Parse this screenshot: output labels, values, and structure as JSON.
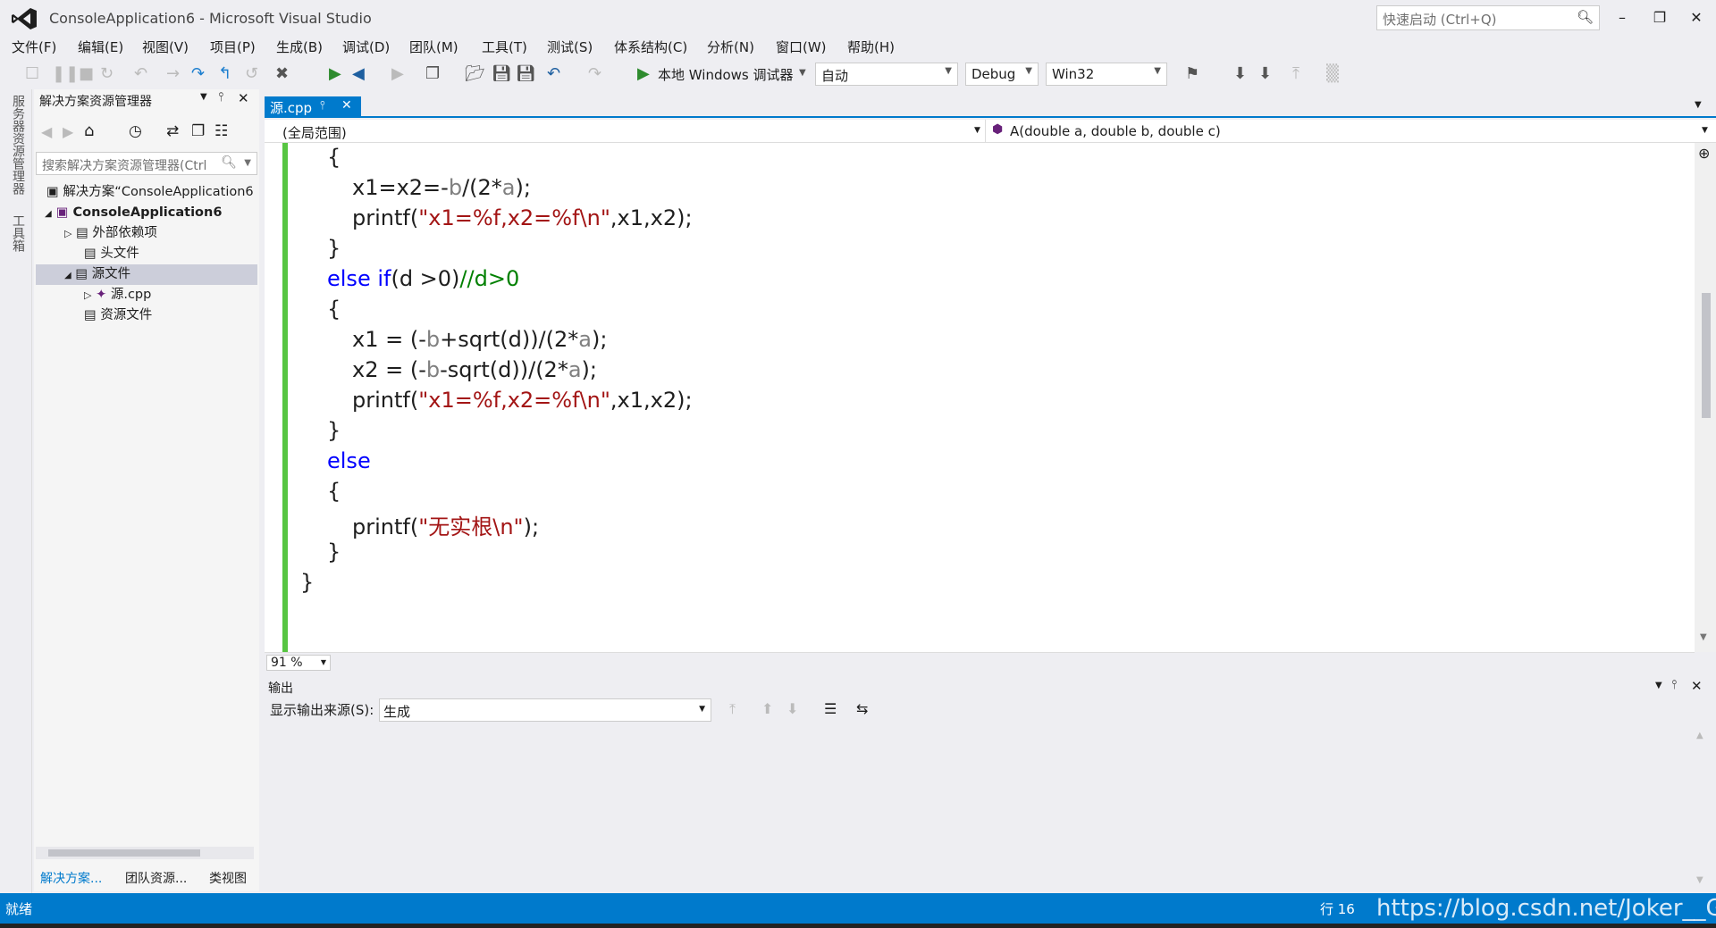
{
  "window": {
    "title": "ConsoleApplication6 - Microsoft Visual Studio",
    "quick_launch_placeholder": "快速启动 (Ctrl+Q)"
  },
  "menu": [
    "文件(F)",
    "编辑(E)",
    "视图(V)",
    "项目(P)",
    "生成(B)",
    "调试(D)",
    "团队(M)",
    "工具(T)",
    "测试(S)",
    "体系结构(C)",
    "分析(N)",
    "窗口(W)",
    "帮助(H)"
  ],
  "toolbar": {
    "debugger": "本地 Windows 调试器",
    "auto": "自动",
    "config": "Debug",
    "platform": "Win32"
  },
  "side_strip": {
    "server_explorer": "服务器资源管理器",
    "toolbox": "工具箱"
  },
  "solution_explorer": {
    "title": "解决方案资源管理器",
    "search_placeholder": "搜索解决方案资源管理器(Ctrl",
    "tree": [
      "解决方案“ConsoleApplication6",
      "ConsoleApplication6",
      "外部依赖项",
      "头文件",
      "源文件",
      "源.cpp",
      "资源文件"
    ],
    "tabs": [
      "解决方案...",
      "团队资源...",
      "类视图"
    ]
  },
  "editor": {
    "tab": "源.cpp",
    "scope": "(全局范围)",
    "member": "A(double a, double b, double c)",
    "zoom": "91 %"
  },
  "output": {
    "title": "输出",
    "source_label": "显示输出来源(S):",
    "source_value": "生成"
  },
  "status": {
    "ready": "就绪",
    "line": "行 16",
    "watermark": "https://blog.csdn.net/Joker__GG"
  },
  "colors": {
    "accent": "#007acc",
    "keyword": "#0000ff",
    "string": "#a31515",
    "comment": "#008000",
    "param": "#808080",
    "gutter": "#57c542"
  }
}
